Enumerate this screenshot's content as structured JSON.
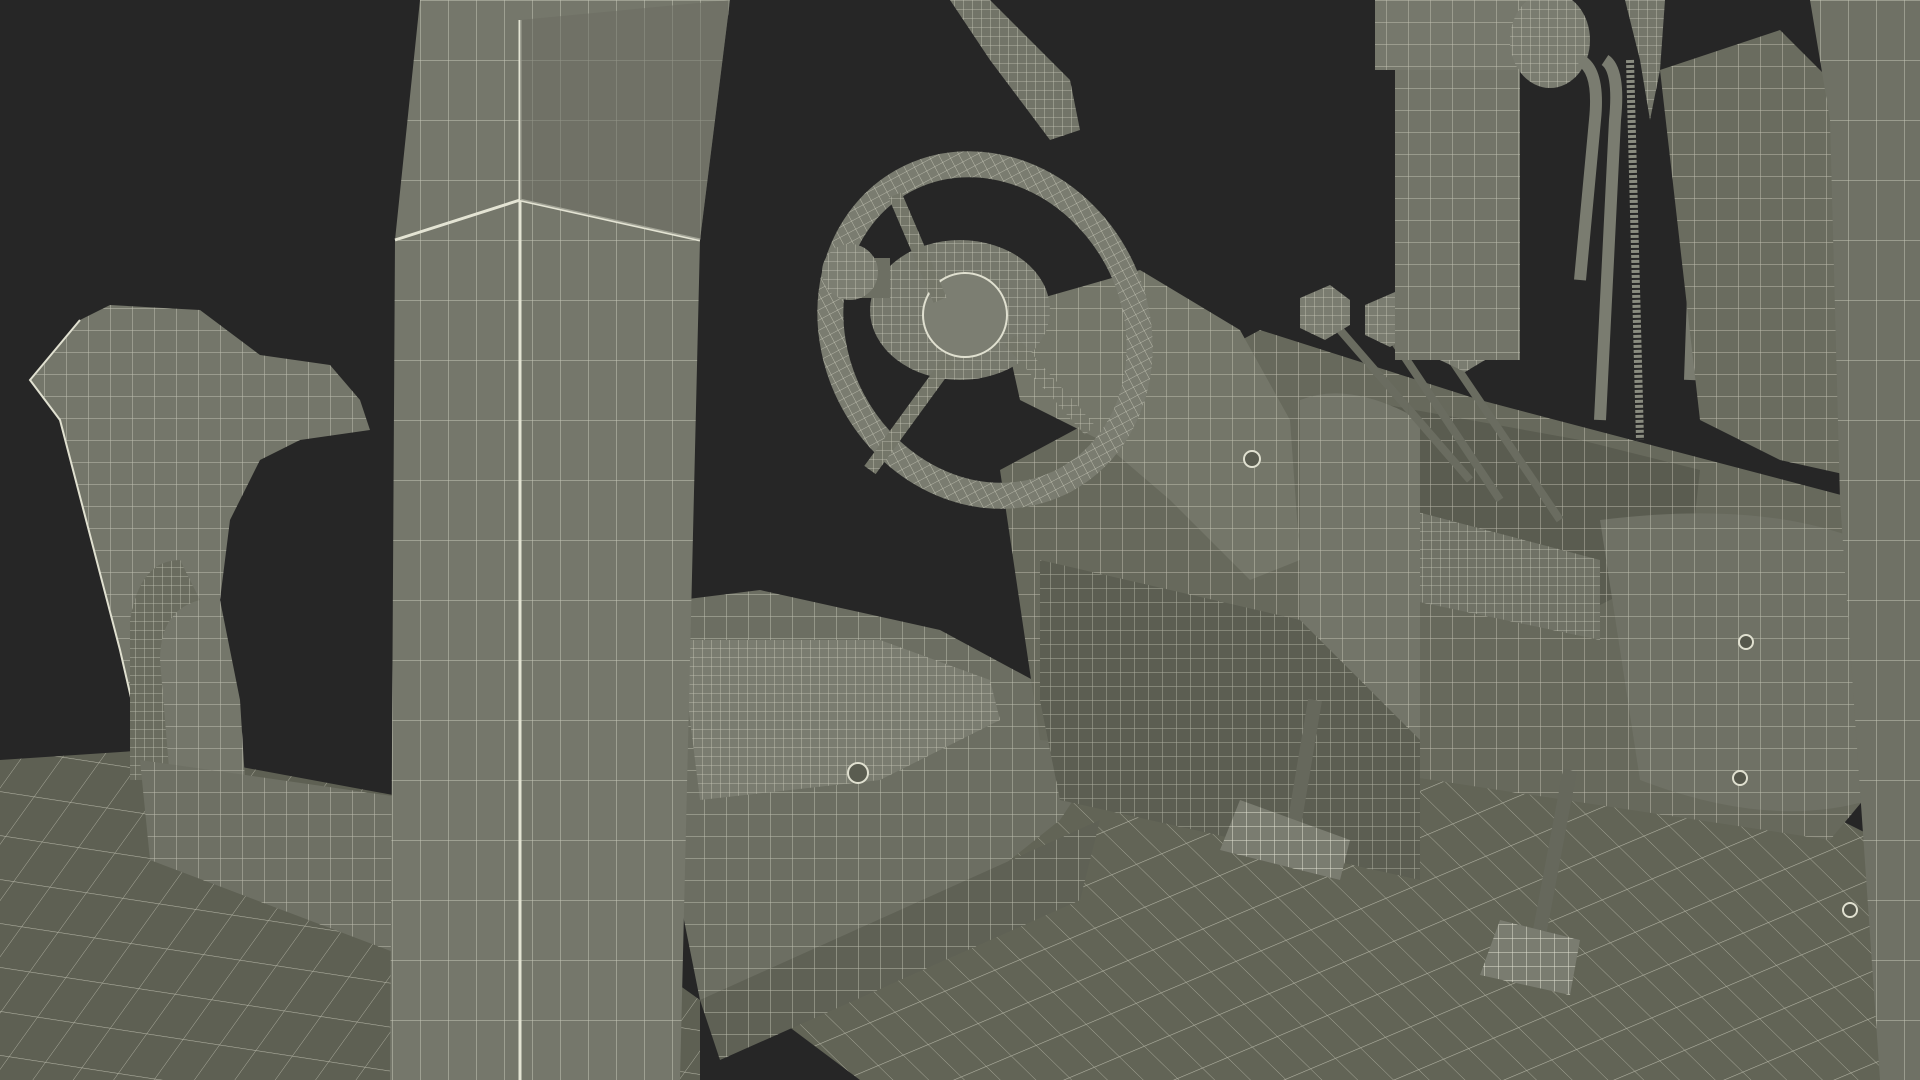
{
  "scene": {
    "subject": "",
    "render_style": "wireframe-on-shaded",
    "colors": {
      "background": "#262626",
      "surface": "#6a6c5f",
      "surface_light": "#7b7d70",
      "surface_dark": "#55574b",
      "wire": "#d8d8c8"
    }
  }
}
